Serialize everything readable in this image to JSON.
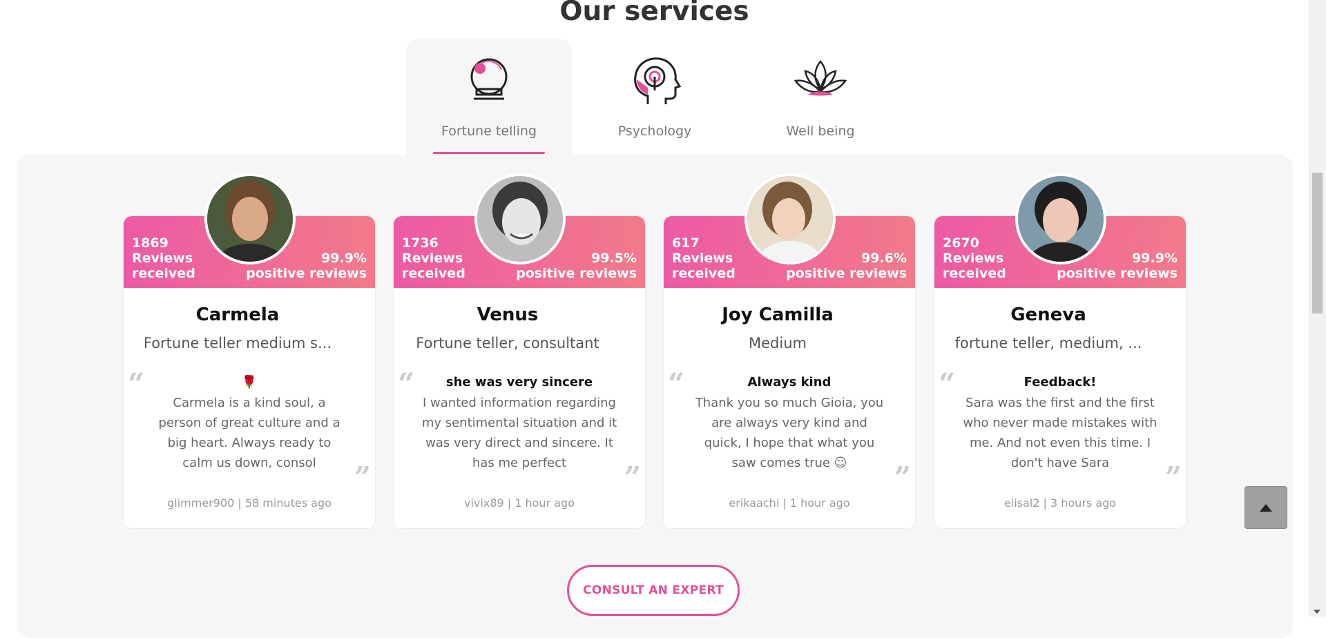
{
  "section": {
    "title": "Our services"
  },
  "tabs": [
    {
      "label": "Fortune telling",
      "icon": "crystal-ball-icon",
      "active": true
    },
    {
      "label": "Psychology",
      "icon": "head-mind-icon",
      "active": false
    },
    {
      "label": "Well being",
      "icon": "lotus-icon",
      "active": false
    }
  ],
  "cards": [
    {
      "reviews_count": "1869",
      "reviews_label_1": "Reviews",
      "reviews_label_2": "received",
      "positive_pct": "99.9%",
      "positive_label": "positive reviews",
      "name": "Carmela",
      "specialty": "Fortune teller medium s...",
      "review_title": "🌹",
      "review_text": "Carmela is a kind soul, a person of great culture and a big heart. Always ready to calm us down, consol",
      "footer": "glimmer900 | 58 minutes ago"
    },
    {
      "reviews_count": "1736",
      "reviews_label_1": "Reviews",
      "reviews_label_2": "received",
      "positive_pct": "99.5%",
      "positive_label": "positive reviews",
      "name": "Venus",
      "specialty": "Fortune teller, consultant",
      "review_title": "she was very sincere",
      "review_text": "I wanted information regarding my sentimental situation and it was very direct and sincere. It has me perfect",
      "footer": "vivix89 | 1 hour ago"
    },
    {
      "reviews_count": "617",
      "reviews_label_1": "Reviews",
      "reviews_label_2": "received",
      "positive_pct": "99.6%",
      "positive_label": "positive reviews",
      "name": "Joy Camilla",
      "specialty": "Medium",
      "review_title": "Always kind",
      "review_text": "Thank you so much Gioia, you are always very kind and quick, I hope that what you saw comes true ☺",
      "footer": "erikaachi | 1 hour ago"
    },
    {
      "reviews_count": "2670",
      "reviews_label_1": "Reviews",
      "reviews_label_2": "received",
      "positive_pct": "99.9%",
      "positive_label": "positive reviews",
      "name": "Geneva",
      "specialty": "fortune teller, medium, ...",
      "review_title": "Feedback!",
      "review_text": "Sara was the first and the first who never made mistakes with me. And not even this time. I don't have Sara",
      "footer": "elisal2 | 3 hours ago"
    }
  ],
  "cta": {
    "label": "CONSULT AN EXPERT"
  },
  "colors": {
    "accent": "#e64f98",
    "band_start": "#ec5aa4",
    "band_end": "#f27a8a"
  }
}
